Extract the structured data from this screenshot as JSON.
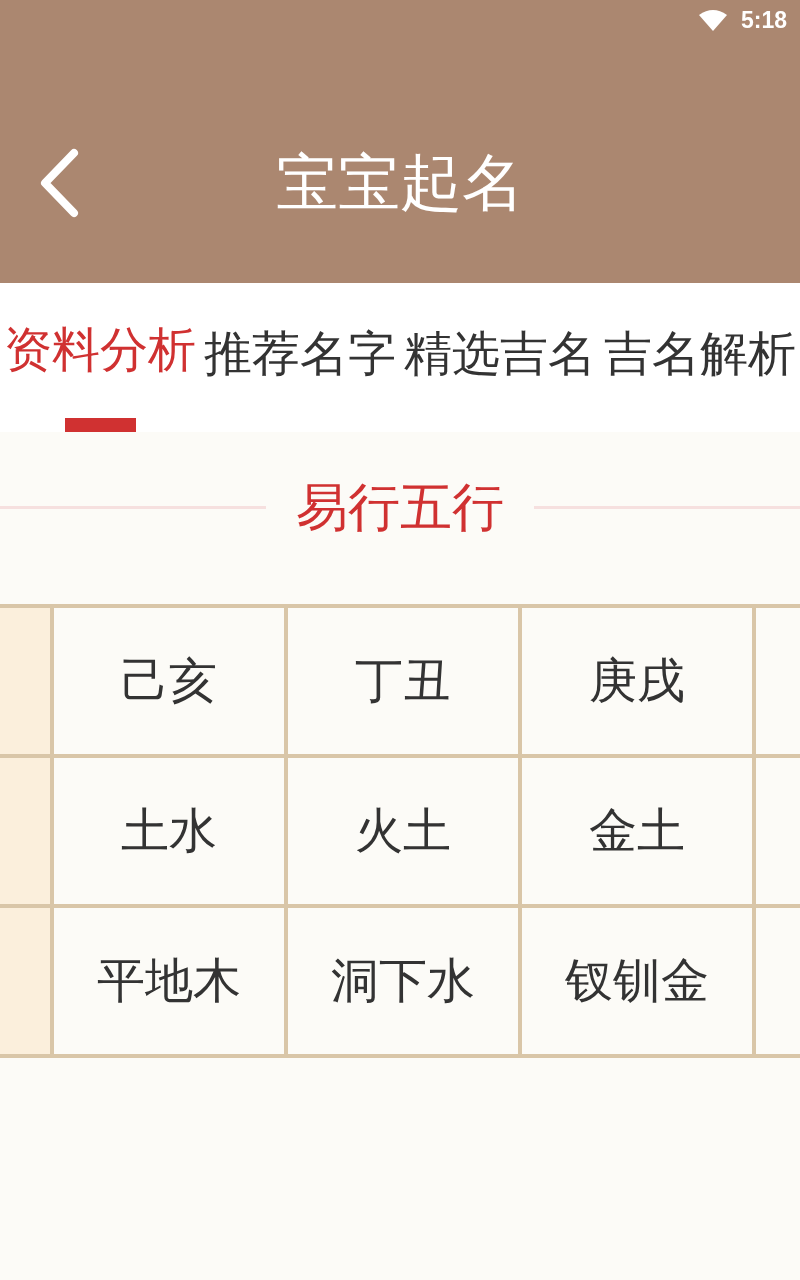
{
  "status_bar": {
    "time": "5:18"
  },
  "header": {
    "title": "宝宝起名"
  },
  "tabs": [
    {
      "label": "资料分析",
      "selected": true
    },
    {
      "label": "推荐名字",
      "selected": false
    },
    {
      "label": "精选吉名",
      "selected": false
    },
    {
      "label": "吉名解析",
      "selected": false
    }
  ],
  "section": {
    "title": "易行五行"
  },
  "table": {
    "rows": [
      {
        "cells": [
          "己亥",
          "丁丑",
          "庚戌"
        ]
      },
      {
        "cells": [
          "土水",
          "火土",
          "金土"
        ]
      },
      {
        "cells": [
          "平地木",
          "洞下水",
          "钗钏金"
        ]
      }
    ]
  }
}
